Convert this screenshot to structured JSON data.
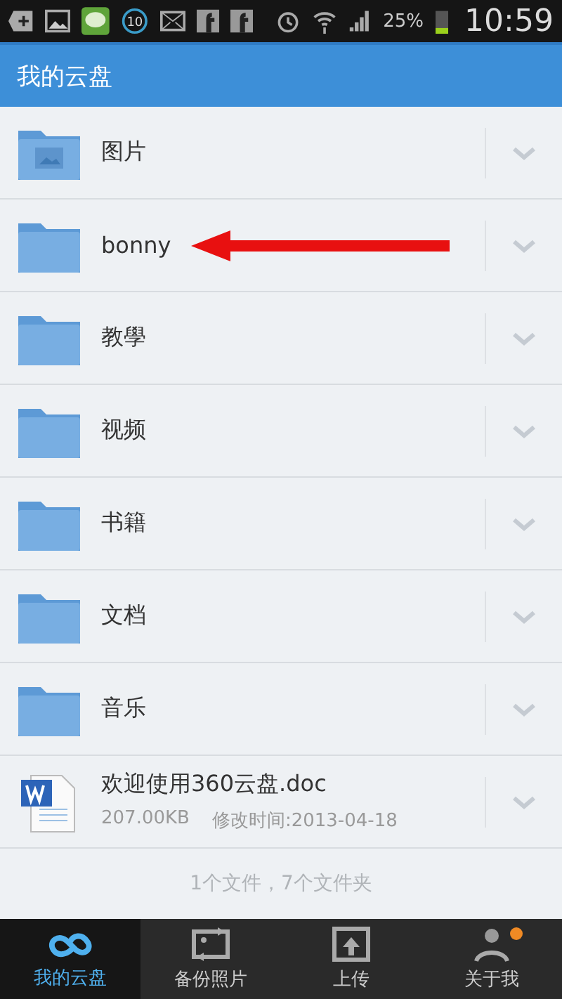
{
  "status_bar": {
    "notification_count": "10",
    "battery_percent": "25%",
    "time": "10:59"
  },
  "header": {
    "title": "我的云盘"
  },
  "items": [
    {
      "kind": "photos",
      "name": "图片"
    },
    {
      "kind": "folder",
      "name": "bonny",
      "pointed": true
    },
    {
      "kind": "folder",
      "name": "教學"
    },
    {
      "kind": "folder",
      "name": "视频"
    },
    {
      "kind": "folder",
      "name": "书籍"
    },
    {
      "kind": "folder",
      "name": "文档"
    },
    {
      "kind": "folder",
      "name": "音乐"
    },
    {
      "kind": "doc",
      "name": "欢迎使用360云盘.doc",
      "size": "207.00KB",
      "modified": "修改时间:2013-04-18"
    }
  ],
  "summary": "1个文件，7个文件夹",
  "nav": [
    {
      "label": "我的云盘",
      "selected": true
    },
    {
      "label": "备份照片",
      "selected": false
    },
    {
      "label": "上传",
      "selected": false
    },
    {
      "label": "关于我",
      "selected": false,
      "badge": true
    }
  ]
}
